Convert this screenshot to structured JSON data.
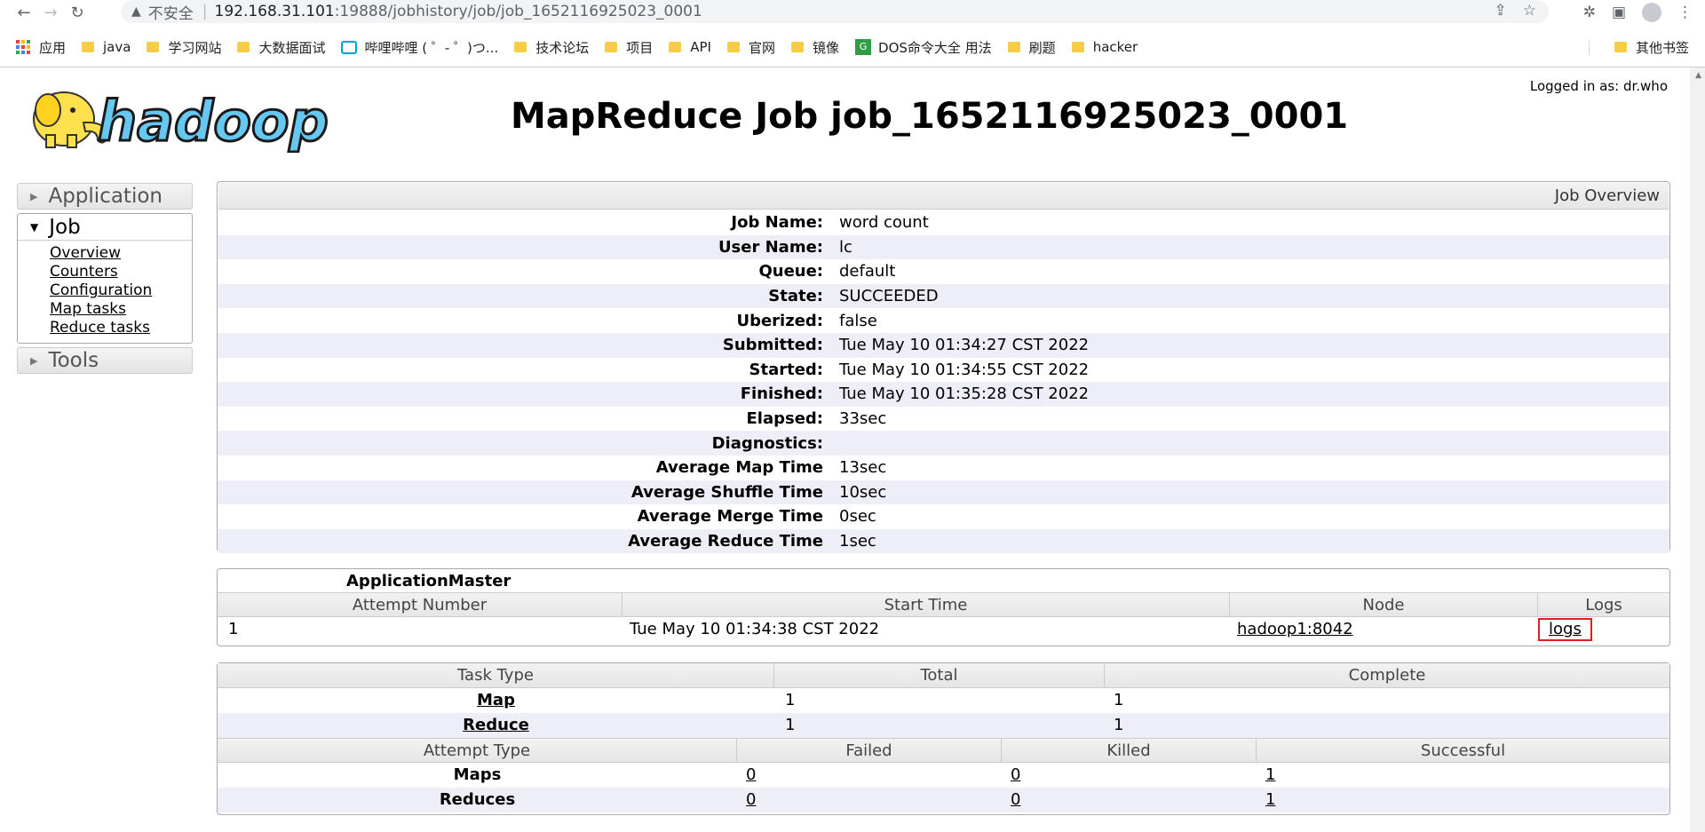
{
  "browser": {
    "insecure_label": "不安全",
    "url_host": "192.168.31.101",
    "url_path": ":19888/jobhistory/job/job_1652116925023_0001",
    "bookmarks": [
      "应用",
      "java",
      "学习网站",
      "大数据面试",
      "哔哩哔哩 ( ゜- ゜)つ...",
      "技术论坛",
      "项目",
      "API",
      "官网",
      "镜像",
      "DOS命令大全 用法",
      "刷题",
      "hacker"
    ],
    "other_bookmarks": "其他书签"
  },
  "header": {
    "logo_text": "hadoop",
    "logged_in": "Logged in as: dr.who",
    "title": "MapReduce Job job_1652116925023_0001"
  },
  "nav": {
    "application": "Application",
    "job": "Job",
    "job_links": [
      "Overview",
      "Counters",
      "Configuration",
      "Map tasks",
      "Reduce tasks"
    ],
    "tools": "Tools"
  },
  "overview": {
    "header": "Job Overview",
    "rows": [
      {
        "label": "Job Name:",
        "value": "word count"
      },
      {
        "label": "User Name:",
        "value": "lc"
      },
      {
        "label": "Queue:",
        "value": "default"
      },
      {
        "label": "State:",
        "value": "SUCCEEDED"
      },
      {
        "label": "Uberized:",
        "value": "false"
      },
      {
        "label": "Submitted:",
        "value": "Tue May 10 01:34:27 CST 2022"
      },
      {
        "label": "Started:",
        "value": "Tue May 10 01:34:55 CST 2022"
      },
      {
        "label": "Finished:",
        "value": "Tue May 10 01:35:28 CST 2022"
      },
      {
        "label": "Elapsed:",
        "value": "33sec"
      },
      {
        "label": "Diagnostics:",
        "value": ""
      },
      {
        "label": "Average Map Time",
        "value": "13sec"
      },
      {
        "label": "Average Shuffle Time",
        "value": "10sec"
      },
      {
        "label": "Average Merge Time",
        "value": "0sec"
      },
      {
        "label": "Average Reduce Time",
        "value": "1sec"
      }
    ]
  },
  "am": {
    "title": "ApplicationMaster",
    "columns": [
      "Attempt Number",
      "Start Time",
      "Node",
      "Logs"
    ],
    "row": {
      "attempt": "1",
      "start": "Tue May 10 01:34:38 CST 2022",
      "node": "hadoop1:8042",
      "logs": "logs"
    }
  },
  "tasks": {
    "columns": [
      "Task Type",
      "Total",
      "Complete"
    ],
    "rows": [
      {
        "type": "Map",
        "total": "1",
        "complete": "1"
      },
      {
        "type": "Reduce",
        "total": "1",
        "complete": "1"
      }
    ],
    "attempt_columns": [
      "Attempt Type",
      "Failed",
      "Killed",
      "Successful"
    ],
    "attempt_rows": [
      {
        "type": "Maps",
        "failed": "0",
        "killed": "0",
        "successful": "1"
      },
      {
        "type": "Reduces",
        "failed": "0",
        "killed": "0",
        "successful": "1"
      }
    ]
  }
}
